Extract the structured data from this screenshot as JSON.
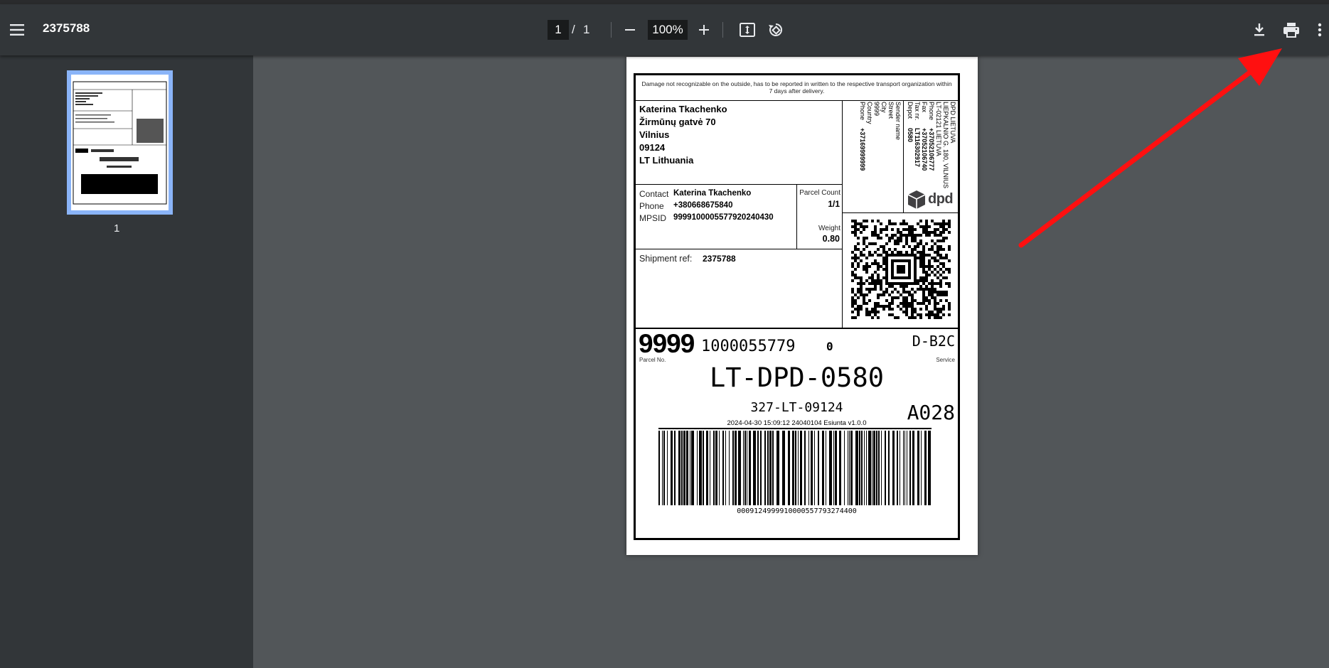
{
  "toolbar": {
    "title": "2375788",
    "page_current": "1",
    "page_separator": "/",
    "page_total": "1",
    "zoom": "100%",
    "icons": [
      "menu-icon",
      "zoom-out-icon",
      "zoom-in-icon",
      "fit-page-icon",
      "rotate-icon",
      "download-icon",
      "print-icon",
      "more-vert-icon"
    ]
  },
  "sidebar": {
    "thumbnail_page": "1"
  },
  "label": {
    "disclaimer": "Damage not recognizable on the outside, has to be reported in written to the respective transport organization within 7 days after delivery.",
    "recipient": [
      "Katerina Tkachenko",
      "Žirmūnų gatvė 70",
      "Vilnius",
      "09124",
      "LT Lithuania"
    ],
    "contact_label": "Contact",
    "contact_value": "Katerina Tkachenko",
    "phone_label": "Phone",
    "phone_value": "+380668675840",
    "mpsid_label": "MPSID",
    "mpsid_value": "9999100005577920240430",
    "parcel_count_label": "Parcel Count",
    "parcel_count_value": "1/1",
    "weight_label": "Weight",
    "weight_value": "0.80",
    "shipment_ref_label": "Shipment ref:",
    "shipment_ref_value": "2375788",
    "sender_company": [
      "DPD LIETUVA",
      "LIEPKALNIO G. 180, VILNIUS",
      "LT-02121 LIETUVA"
    ],
    "sender_phone_label": "Phone",
    "sender_phone_value": "+37052106777",
    "sender_fax_label": "Fax",
    "sender_fax_value": "+37052106740",
    "sender_tax_label": "Tax nr.",
    "sender_tax_value": "LT116302917",
    "sender_depot_label": "Depot",
    "sender_depot_value": "0580",
    "sender_name_label": "Sender name",
    "street_label": "Street",
    "city_label": "City",
    "zip_label": "9999",
    "country_label": "Country",
    "country_phone_label": "Phone",
    "country_phone_value": "+37169999999",
    "dpd_logo_text": "dpd",
    "parcel_prefix": "9999",
    "parcel_number": "1000055779",
    "parcel_check": "0",
    "service_code": "D-B2C",
    "parcel_no_caption": "Parcel No.",
    "service_caption": "Service",
    "route_code": "LT-DPD-0580",
    "postal_route": "327-LT-09124",
    "sort_code": "A028",
    "timestamp_line": "2024-04-30 15:09:12 24040104 Esiunta v1.0.0",
    "barcode_number": "0009124999910000557793274400"
  },
  "colors": {
    "toolbar_bg": "#323639",
    "viewer_bg": "#525659",
    "thumb_highlight": "#8ab4f8",
    "arrow": "#ff1010"
  }
}
